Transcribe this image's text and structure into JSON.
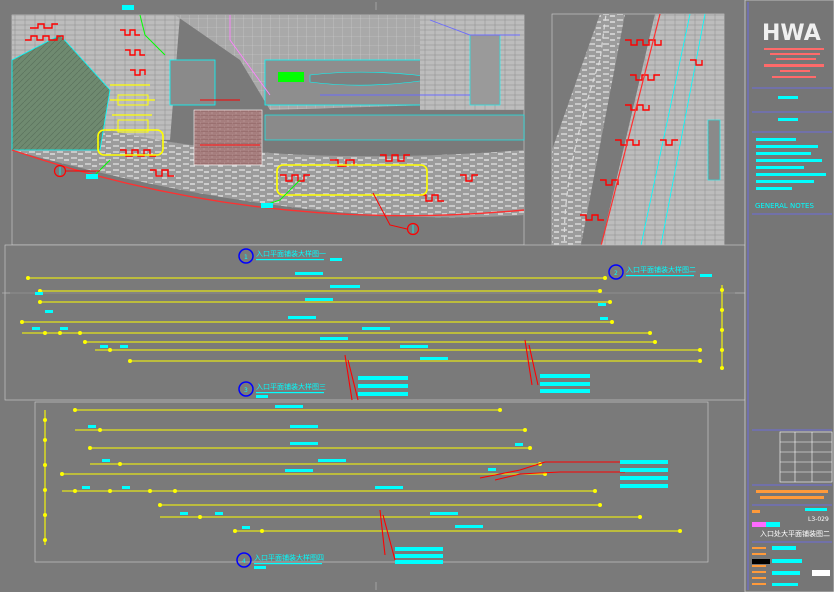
{
  "drawing": {
    "viewport_labels": {
      "view1": "入口平面铺装大样图一",
      "view2": "入口平面铺装大样图二",
      "view3": "入口平面铺装大样图三",
      "view4": "入口平面铺装大样图四"
    },
    "section_callouts": [
      "1",
      "2",
      "3",
      "4"
    ]
  },
  "title_block": {
    "logo": "HWA",
    "general_notes": "GENERAL NOTES",
    "sheet_no": "L3-029",
    "sheet_title": "入口处大平面铺装图二"
  },
  "colors": {
    "background": "#7a7a7a",
    "paving": "#b8b8b8",
    "brick": "#8c8c8c",
    "red": "#ff0000",
    "yellow": "#ffff00",
    "cyan": "#00ffff",
    "green": "#00ff00",
    "blue": "#0000ff",
    "magenta": "#ff80ff",
    "white": "#ffffff"
  }
}
